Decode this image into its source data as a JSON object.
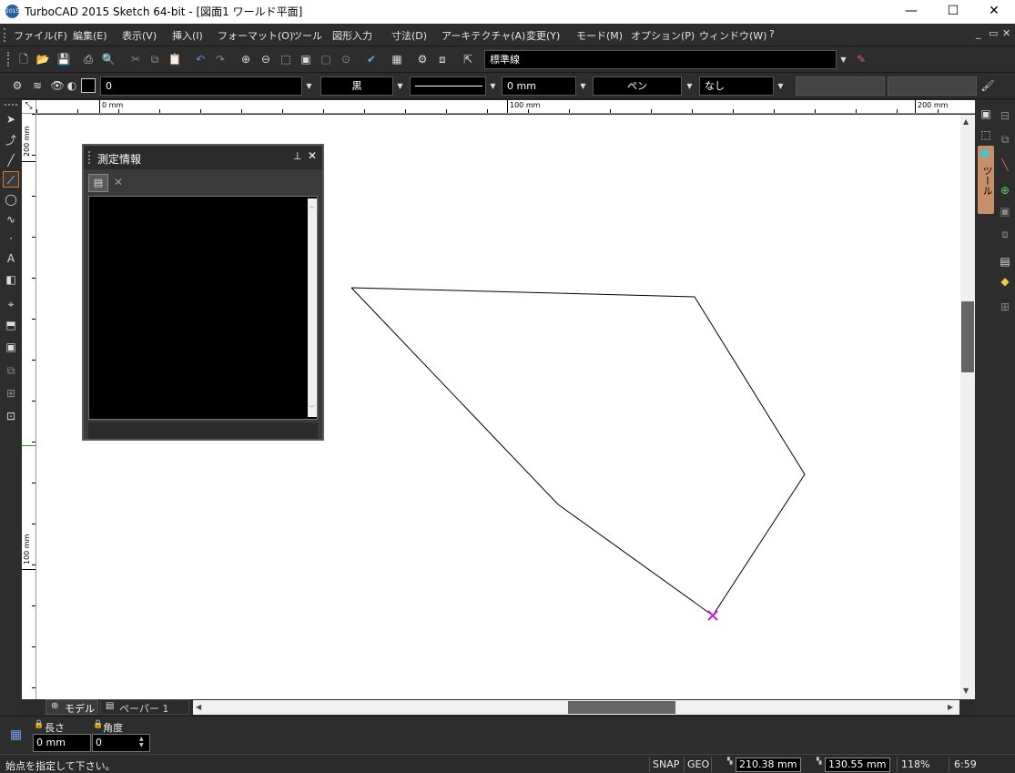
{
  "window": {
    "title": "TurboCAD 2015 Sketch 64-bit - [図面1 ワールド平面]",
    "app_icon_text": "2015",
    "controls": {
      "minimize": "—",
      "maximize": "☐",
      "close": "✕"
    }
  },
  "menubar": {
    "items": [
      "ファイル(F)",
      "編集(E)",
      "表示(V)",
      "挿入(I)",
      "フォーマット(O)",
      "ツール",
      "図形入力",
      "寸法(D)",
      "アーキテクチャ(A)",
      "変更(Y)",
      "モード(M)",
      "オプション(P)",
      "ウィンドウ(W)",
      "?"
    ],
    "mdi_controls": {
      "minimize": "_",
      "restore": "▭",
      "close": "✕"
    }
  },
  "standard_toolbar": {
    "layer_combo_value": "標準線"
  },
  "property_toolbar": {
    "layer_value": "0",
    "color_value": "黒",
    "linewidth_value": "0 mm",
    "pen_value": "ペン",
    "style_value": "なし"
  },
  "rulers": {
    "horizontal": [
      "0 mm",
      "100 mm",
      "200 mm"
    ],
    "vertical": [
      "200 mm",
      "100 mm"
    ]
  },
  "palette": {
    "title": "測定情報",
    "pin_icon": "pin-icon",
    "close_icon": "close-icon"
  },
  "right_panel": {
    "tab_label": "ツール"
  },
  "sheet_tabs": {
    "model": "モデル",
    "paper": "ペーパー 1"
  },
  "inspector": {
    "length_label": "長さ",
    "length_value": "0 mm",
    "angle_label": "角度",
    "angle_value": "0"
  },
  "statusbar": {
    "prompt": "始点を指定して下さい。",
    "snap": "SNAP",
    "geo": "GEO",
    "x_coord": "210.38 mm",
    "y_coord": "130.55 mm",
    "zoom": "118%",
    "time": "6:59"
  },
  "colors": {
    "ui_dark": "#2d2d2d",
    "canvas": "#ffffff",
    "marker": "#d020c0",
    "active_tool": "#e07820"
  }
}
